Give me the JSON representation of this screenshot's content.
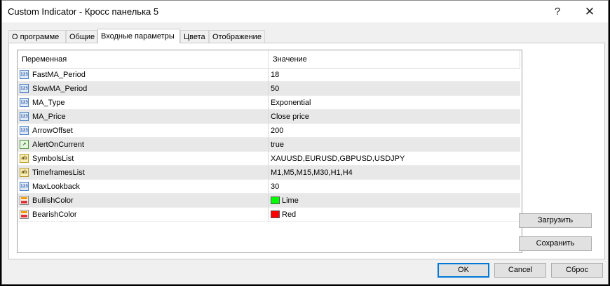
{
  "window": {
    "title": "Custom Indicator - Кросс панелька 5",
    "help_glyph": "?",
    "close_glyph": "✕"
  },
  "tabs": [
    {
      "label": "О программе",
      "active": false
    },
    {
      "label": "Общие",
      "active": false
    },
    {
      "label": "Входные параметры",
      "active": true
    },
    {
      "label": "Цвета",
      "active": false
    },
    {
      "label": "Отображение",
      "active": false
    }
  ],
  "grid": {
    "headers": {
      "variable": "Переменная",
      "value": "Значение"
    },
    "rows": [
      {
        "icon": "int",
        "icon_text": "123",
        "name": "FastMA_Period",
        "value": "18"
      },
      {
        "icon": "int",
        "icon_text": "123",
        "name": "SlowMA_Period",
        "value": "50"
      },
      {
        "icon": "int",
        "icon_text": "123",
        "name": "MA_Type",
        "value": "Exponential"
      },
      {
        "icon": "int",
        "icon_text": "123",
        "name": "MA_Price",
        "value": "Close price"
      },
      {
        "icon": "int",
        "icon_text": "123",
        "name": "ArrowOffset",
        "value": "200"
      },
      {
        "icon": "bool",
        "icon_text": "↗",
        "name": "AlertOnCurrent",
        "value": "true"
      },
      {
        "icon": "str",
        "icon_text": "ab",
        "name": "SymbolsList",
        "value": "XAUUSD,EURUSD,GBPUSD,USDJPY"
      },
      {
        "icon": "str",
        "icon_text": "ab",
        "name": "TimeframesList",
        "value": "M1,M5,M15,M30,H1,H4"
      },
      {
        "icon": "int",
        "icon_text": "123",
        "name": "MaxLookback",
        "value": "30"
      },
      {
        "icon": "color",
        "icon_text": "",
        "name": "BullishColor",
        "value": "Lime",
        "swatch": "#00ff00"
      },
      {
        "icon": "color",
        "icon_text": "",
        "name": "BearishColor",
        "value": "Red",
        "swatch": "#ff0000"
      }
    ]
  },
  "side_buttons": {
    "load": "Загрузить",
    "save": "Сохранить"
  },
  "footer_buttons": {
    "ok": "OK",
    "cancel": "Cancel",
    "reset": "Сброс"
  }
}
